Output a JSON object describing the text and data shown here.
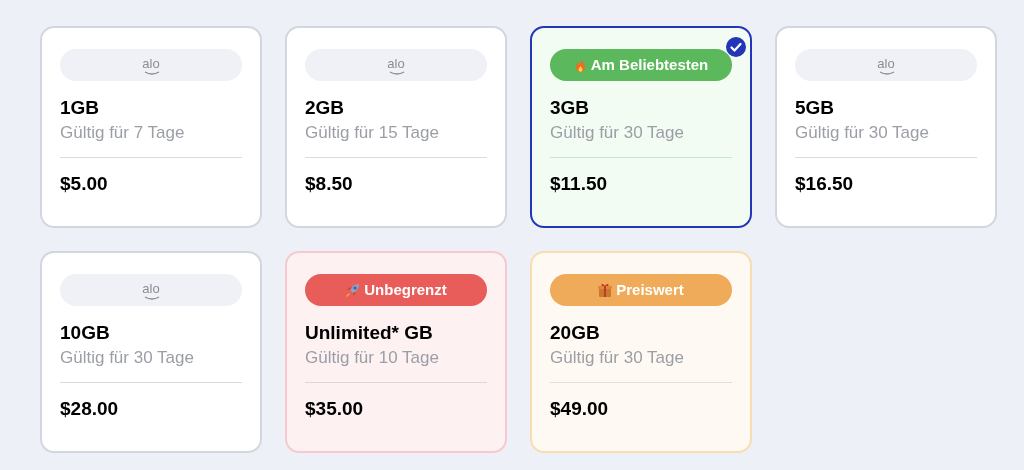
{
  "plans": [
    {
      "kind": "standard",
      "tag": {
        "text": "alo"
      },
      "data": "1GB",
      "validity": "Gültig für 7 Tage",
      "price": "$5.00",
      "selected": false
    },
    {
      "kind": "standard",
      "tag": {
        "text": "alo"
      },
      "data": "2GB",
      "validity": "Gültig für 15 Tage",
      "price": "$8.50",
      "selected": false
    },
    {
      "kind": "popular",
      "tag": {
        "text": "Am Beliebtesten",
        "color": "#5cb85c"
      },
      "data": "3GB",
      "validity": "Gültig für 30 Tage",
      "price": "$11.50",
      "selected": true
    },
    {
      "kind": "standard",
      "tag": {
        "text": "alo"
      },
      "data": "5GB",
      "validity": "Gültig für 30 Tage",
      "price": "$16.50",
      "selected": false
    },
    {
      "kind": "standard",
      "tag": {
        "text": "alo"
      },
      "data": "10GB",
      "validity": "Gültig für 30 Tage",
      "price": "$28.00",
      "selected": false
    },
    {
      "kind": "unlimited",
      "tag": {
        "text": "Unbegrenzt",
        "color": "#e85d5a"
      },
      "data": "Unlimited* GB",
      "validity": "Gültig für 10 Tage",
      "price": "$35.00",
      "selected": false
    },
    {
      "kind": "value",
      "tag": {
        "text": "Preiswert",
        "color": "#f0ab5a"
      },
      "data": "20GB",
      "validity": "Gültig für 30 Tage",
      "price": "$49.00",
      "selected": false
    }
  ]
}
